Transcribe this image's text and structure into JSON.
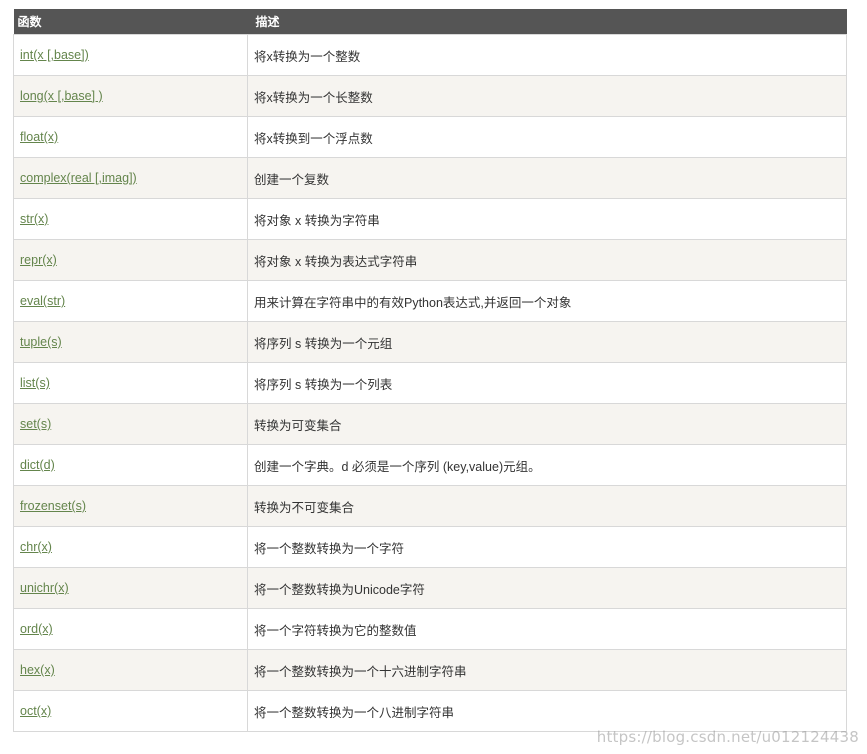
{
  "table": {
    "headers": [
      "函数",
      "描述"
    ],
    "rows": [
      {
        "func": "int(x [,base])",
        "desc": "将x转换为一个整数"
      },
      {
        "func": "long(x [,base] )",
        "desc": "将x转换为一个长整数"
      },
      {
        "func": "float(x)",
        "desc": "将x转换到一个浮点数"
      },
      {
        "func": "complex(real [,imag])",
        "desc": "创建一个复数"
      },
      {
        "func": "str(x)",
        "desc": "将对象 x 转换为字符串"
      },
      {
        "func": "repr(x)",
        "desc": "将对象 x 转换为表达式字符串"
      },
      {
        "func": "eval(str)",
        "desc": "用来计算在字符串中的有效Python表达式,并返回一个对象"
      },
      {
        "func": "tuple(s)",
        "desc": "将序列 s 转换为一个元组"
      },
      {
        "func": "list(s)",
        "desc": "将序列 s 转换为一个列表"
      },
      {
        "func": "set(s)",
        "desc": "转换为可变集合"
      },
      {
        "func": "dict(d)",
        "desc": "创建一个字典。d 必须是一个序列 (key,value)元组。"
      },
      {
        "func": "frozenset(s)",
        "desc": "转换为不可变集合"
      },
      {
        "func": "chr(x)",
        "desc": "将一个整数转换为一个字符"
      },
      {
        "func": "unichr(x)",
        "desc": "将一个整数转换为Unicode字符"
      },
      {
        "func": "ord(x)",
        "desc": "将一个字符转换为它的整数值"
      },
      {
        "func": "hex(x)",
        "desc": "将一个整数转换为一个十六进制字符串"
      },
      {
        "func": "oct(x)",
        "desc": "将一个整数转换为一个八进制字符串"
      }
    ]
  },
  "watermark": "https://blog.csdn.net/u012124438",
  "colors": {
    "header_bg": "#555555",
    "link": "#64854c",
    "row_alt": "#f6f4f0"
  }
}
